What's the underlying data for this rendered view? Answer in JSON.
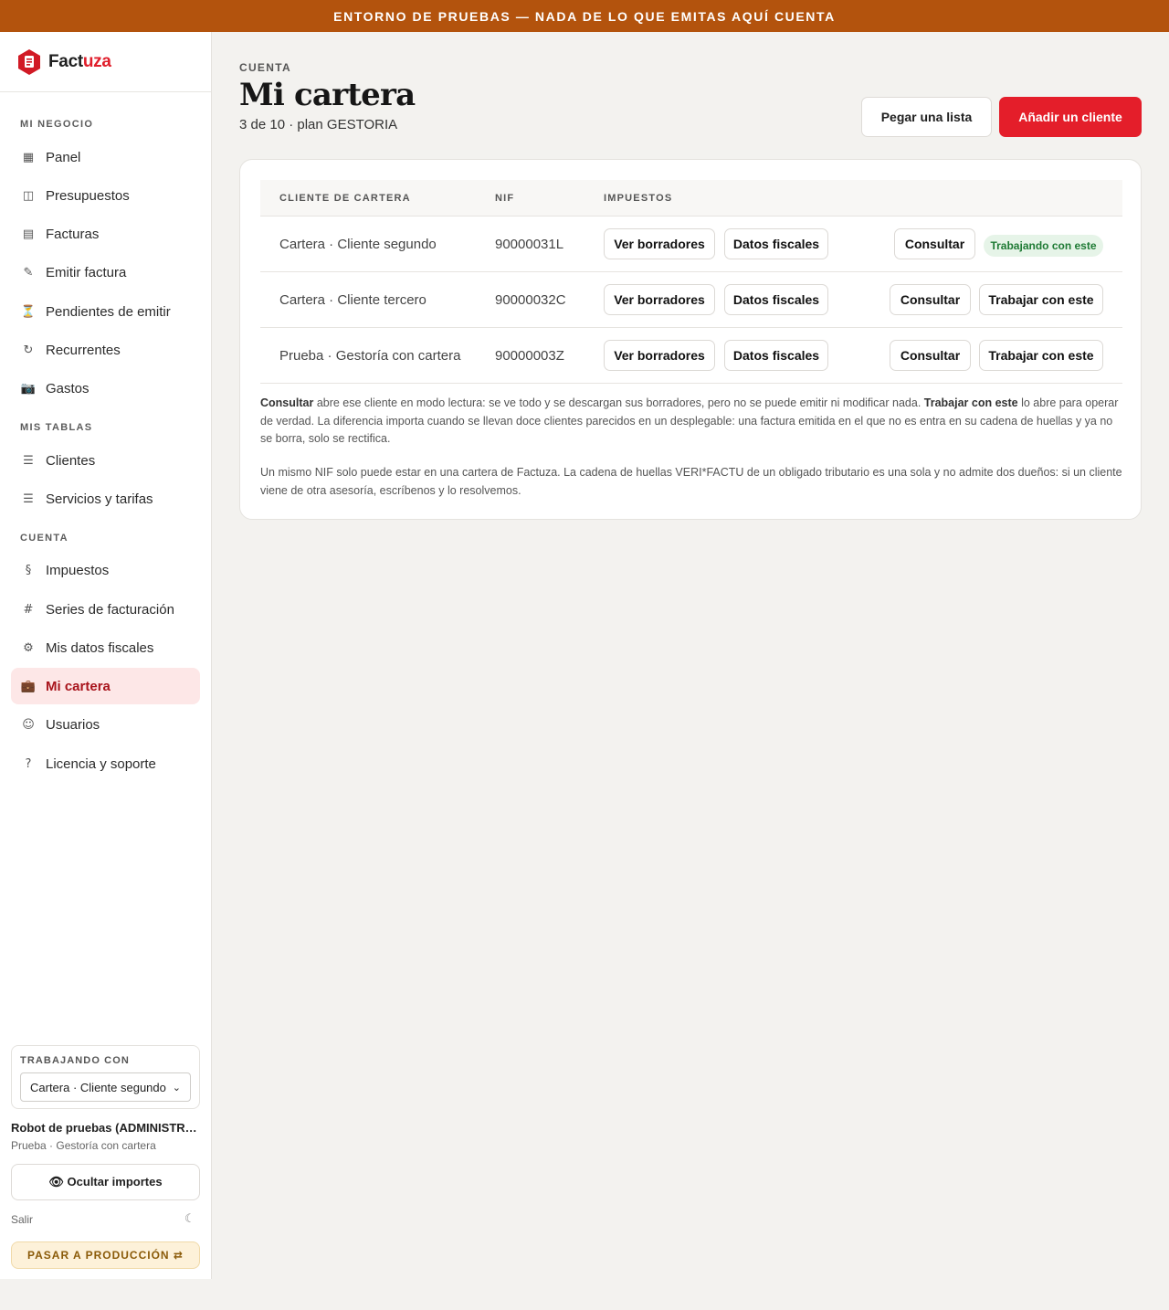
{
  "banner": "ENTORNO DE PRUEBAS — NADA DE LO QUE EMITAS AQUÍ CUENTA",
  "brand": {
    "name_a": "Fact",
    "name_b": "uza"
  },
  "sidebar": {
    "section1": "MI NEGOCIO",
    "section2": "MIS TABLAS",
    "section3": "CUENTA",
    "items": [
      {
        "label": "Panel",
        "icon": "▦"
      },
      {
        "label": "Presupuestos",
        "icon": "◫"
      },
      {
        "label": "Facturas",
        "icon": "▤"
      },
      {
        "label": "Emitir factura",
        "icon": "✎"
      },
      {
        "label": "Pendientes de emitir",
        "icon": "⏳"
      },
      {
        "label": "Recurrentes",
        "icon": "↻"
      },
      {
        "label": "Gastos",
        "icon": "📷"
      },
      {
        "label": "Clientes",
        "icon": "☰"
      },
      {
        "label": "Servicios y tarifas",
        "icon": "☰"
      },
      {
        "label": "Impuestos",
        "icon": "§"
      },
      {
        "label": "Series de facturación",
        "icon": "#"
      },
      {
        "label": "Mis datos fiscales",
        "icon": "⚙"
      },
      {
        "label": "Mi cartera",
        "icon": "💼"
      },
      {
        "label": "Usuarios",
        "icon": "☺"
      },
      {
        "label": "Licencia y soporte",
        "icon": "?"
      }
    ],
    "working_label": "TRABAJANDO CON",
    "working_value": "Cartera · Cliente segundo",
    "user_name": "Robot de pruebas (ADMINISTRADOR)",
    "user_org": "Prueba · Gestoría con cartera",
    "hide_amounts": "👁 Ocultar importes",
    "logout": "Salir",
    "theme_icon": "☾",
    "to_production": "PASAR A PRODUCCIÓN ⇄"
  },
  "header": {
    "eyebrow": "CUENTA",
    "title": "Mi cartera",
    "subtitle": "3 de 10 · plan GESTORIA",
    "paste_button": "Pegar una lista",
    "add_button": "Añadir un cliente"
  },
  "table": {
    "columns": [
      "CLIENTE DE CARTERA",
      "NIF",
      "IMPUESTOS"
    ],
    "btn_drafts": "Ver borradores",
    "btn_fiscal": "Datos fiscales",
    "btn_consult": "Consultar",
    "btn_work": "Trabajar con este",
    "badge_working": "Trabajando con este",
    "rows": [
      {
        "name": "Cartera · Cliente segundo",
        "nif": "90000031L"
      },
      {
        "name": "Cartera · Cliente tercero",
        "nif": "90000032C"
      },
      {
        "name": "Prueba · Gestoría con cartera",
        "nif": "90000003Z"
      }
    ]
  },
  "notes": {
    "p1_b1": "Consultar",
    "p1_t1": " abre ese cliente en modo lectura: se ve todo y se descargan sus borradores, pero no se puede emitir ni modificar nada. ",
    "p1_b2": "Trabajar con este",
    "p1_t2": " lo abre para operar de verdad. La diferencia importa cuando se llevan doce clientes parecidos en un desplegable: una factura emitida en el que no es entra en su cadena de huellas y ya no se borra, solo se rectifica.",
    "p2": "Un mismo NIF solo puede estar en una cartera de Factuza. La cadena de huellas VERI*FACTU de un obligado tributario es una sola y no admite dos dueños: si un cliente viene de otra asesoría, escríbenos y lo resolvemos."
  }
}
